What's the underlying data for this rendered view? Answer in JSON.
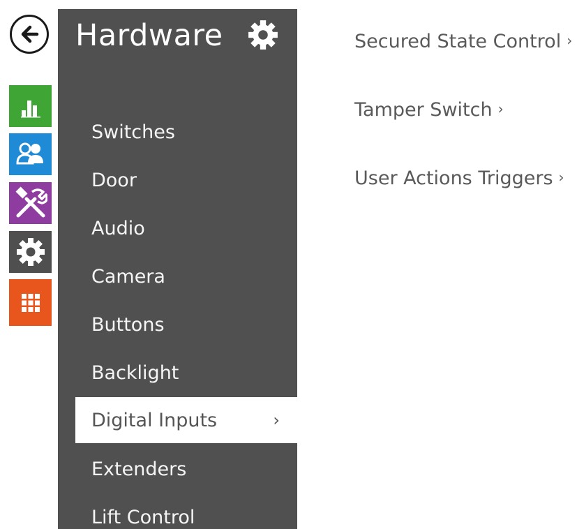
{
  "nav_rail": {
    "back_icon": "back-arrow-icon",
    "tiles": [
      {
        "name": "status",
        "icon": "bar-chart-icon",
        "color": "#3fa535"
      },
      {
        "name": "directory",
        "icon": "users-icon",
        "color": "#1f8ad6"
      },
      {
        "name": "services",
        "icon": "tools-icon",
        "color": "#8e3c9f"
      },
      {
        "name": "hardware",
        "icon": "gear-icon",
        "color": "#4f4f4f"
      },
      {
        "name": "system",
        "icon": "grid-icon",
        "color": "#e8561e"
      }
    ]
  },
  "sidebar": {
    "title": "Hardware",
    "title_icon": "gear-icon",
    "background": "#505050",
    "items": [
      {
        "label": "Switches"
      },
      {
        "label": "Door"
      },
      {
        "label": "Audio"
      },
      {
        "label": "Camera"
      },
      {
        "label": "Buttons"
      },
      {
        "label": "Backlight"
      },
      {
        "label": "Digital Inputs",
        "active": true,
        "chevron": "›"
      },
      {
        "label": "Extenders"
      },
      {
        "label": "Lift Control"
      }
    ]
  },
  "content": {
    "links": [
      {
        "label": "Secured State Control",
        "chevron": "›"
      },
      {
        "label": "Tamper Switch",
        "chevron": "›"
      },
      {
        "label": "User Actions Triggers",
        "chevron": "›"
      }
    ]
  }
}
